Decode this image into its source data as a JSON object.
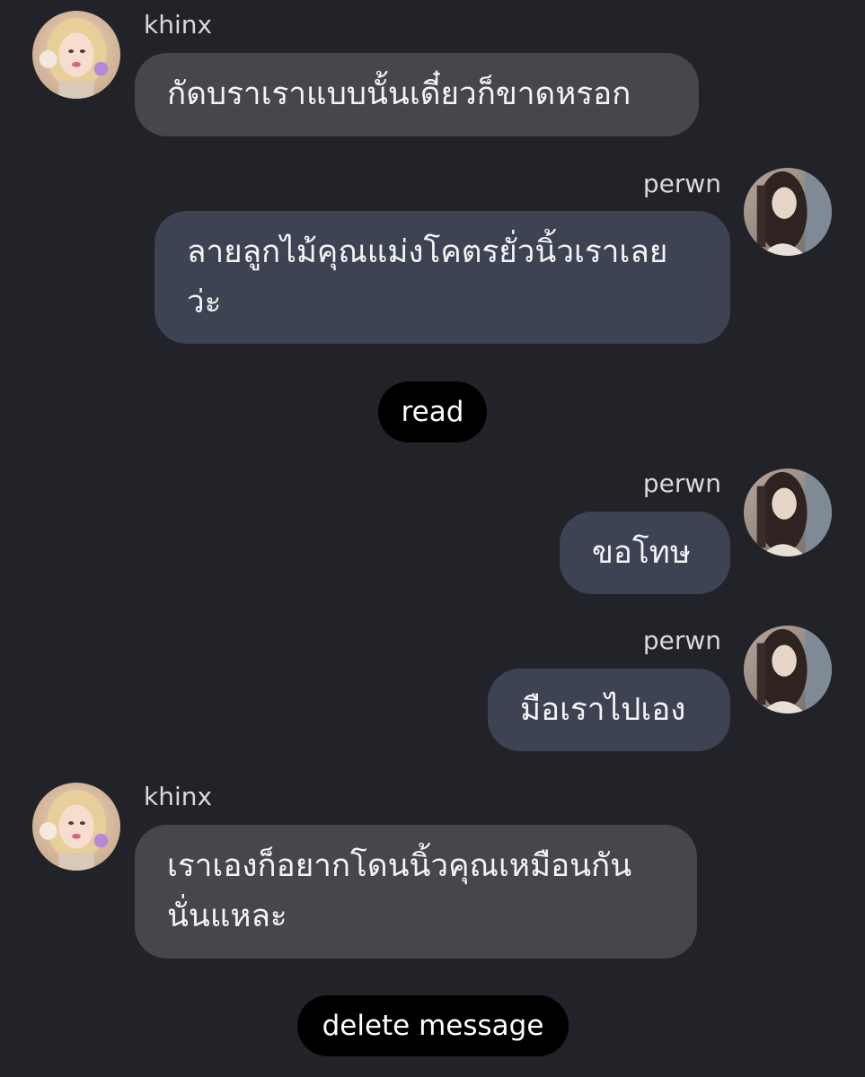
{
  "colors": {
    "background": "#222329",
    "incoming_bubble": "#45474d",
    "outgoing_bubble": "#3d4353",
    "action_pill": "#000000"
  },
  "messages": [
    {
      "sender": "khinx",
      "side": "left",
      "avatar_icon": "profile-photo-blonde-icon",
      "text": "กัดบราเราแบบนั้นเดี๋ยวก็ขาดหรอก"
    },
    {
      "sender": "perwn",
      "side": "right",
      "avatar_icon": "profile-photo-dark-hair-icon",
      "text": "ลายลูกไม้คุณแม่งโคตรยั่วนิ้วเราเลย\nว่ะ"
    },
    {
      "sender": "perwn",
      "side": "right",
      "avatar_icon": "profile-photo-dark-hair-icon",
      "text": "ขอโทษ"
    },
    {
      "sender": "perwn",
      "side": "right",
      "avatar_icon": "profile-photo-dark-hair-icon",
      "text": "มือเราไปเอง"
    },
    {
      "sender": "khinx",
      "side": "left",
      "avatar_icon": "profile-photo-blonde-icon",
      "text": "เราเองก็อยากโดนนิ้วคุณเหมือนกัน\nนั่นแหละ"
    }
  ],
  "actions": {
    "read_label": "read",
    "delete_label": "delete message"
  }
}
